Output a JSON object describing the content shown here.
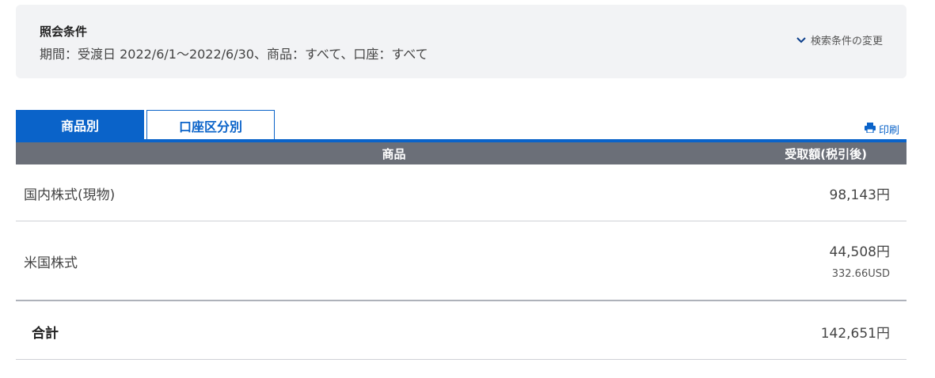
{
  "condition": {
    "title": "照会条件",
    "detail": "期間：受渡日 2022/6/1〜2022/6/30、商品：すべて、口座：すべて",
    "change_label": "検索条件の変更"
  },
  "tabs": [
    {
      "label": "商品別",
      "active": true
    },
    {
      "label": "口座区分別",
      "active": false
    }
  ],
  "print_label": "印刷",
  "table": {
    "headers": {
      "product": "商品",
      "amount": "受取額(税引後)"
    },
    "rows": [
      {
        "product": "国内株式(現物)",
        "amount": "98,143円",
        "sub": ""
      },
      {
        "product": "米国株式",
        "amount": "44,508円",
        "sub": "332.66USD"
      }
    ],
    "total": {
      "label": "合計",
      "amount": "142,651円"
    }
  },
  "colors": {
    "accent": "#0a63c9",
    "header_bg": "#6b6f78",
    "panel_bg": "#f2f3f5"
  },
  "icons": {
    "change": "chevron-down-icon",
    "print": "printer-icon"
  }
}
